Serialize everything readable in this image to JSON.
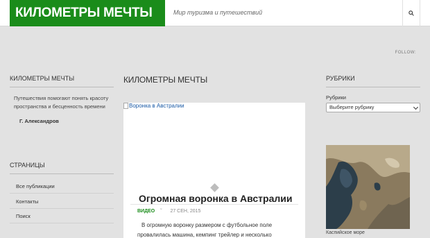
{
  "header": {
    "logo_text": "КИЛОМЕТРЫ МЕЧТЫ",
    "tagline": "Мир туризма и путешествий",
    "search_icon": "search-icon"
  },
  "social": {
    "follow_label": "FOLLOW:"
  },
  "left_sidebar": {
    "about_title": "КИЛОМЕТРЫ МЕЧТЫ",
    "quote": "Путешествия помогают понять красоту пространства и бесценность времени",
    "quote_author": "Г. Александров",
    "pages_title": "СТРАНИЦЫ",
    "pages": [
      "Все публикации",
      "Контакты",
      "Поиск"
    ]
  },
  "main": {
    "section_title": "КИЛОМЕТРЫ МЕЧТЫ",
    "post": {
      "image_alt": "Воронка в Австралии",
      "title": "Огромная воронка в Австралии",
      "category": "ВИДЕО",
      "date": "27 СЕН, 2015",
      "excerpt": "В огромную воронку размером с футбольное поле провалилась машина, кемпинг трейлер и несколько"
    }
  },
  "right_sidebar": {
    "rubrics_title": "РУБРИКИ",
    "rubrics_label": "Рубрики",
    "rubrics_select_value": "Выберите рубрику",
    "photo_caption": "Каспийское море"
  },
  "colors": {
    "accent_green": "#1a8c1a",
    "link_blue": "#1a5aa6",
    "background": "#e2e2e2"
  }
}
